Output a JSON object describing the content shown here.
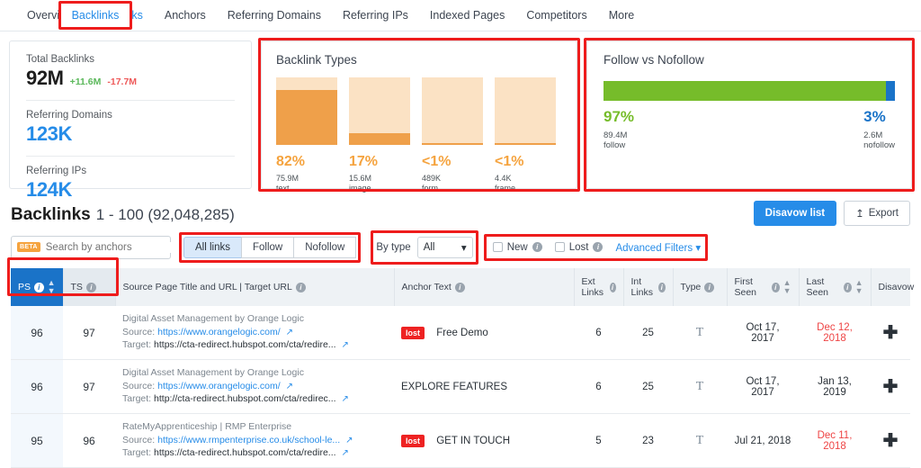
{
  "nav": {
    "items": [
      {
        "label": "Overview",
        "active": false
      },
      {
        "label": "Backlinks",
        "active": true
      },
      {
        "label": "Anchors",
        "active": false
      },
      {
        "label": "Referring Domains",
        "active": false
      },
      {
        "label": "Referring IPs",
        "active": false
      },
      {
        "label": "Indexed Pages",
        "active": false
      },
      {
        "label": "Competitors",
        "active": false
      },
      {
        "label": "More",
        "active": false
      }
    ]
  },
  "stats": {
    "total_backlinks": {
      "label": "Total Backlinks",
      "value": "92M",
      "delta_up": "+11.6M",
      "delta_down": "-17.7M"
    },
    "referring_domains": {
      "label": "Referring Domains",
      "value": "123K"
    },
    "referring_ips": {
      "label": "Referring IPs",
      "value": "124K"
    }
  },
  "chart_data": [
    {
      "type": "bar",
      "title": "Backlink Types",
      "categories": [
        "text",
        "image",
        "form",
        "frame"
      ],
      "values": [
        82,
        17,
        0.5,
        0.01
      ],
      "value_labels": [
        "82%",
        "17%",
        "<1%",
        "<1%"
      ],
      "absolute_labels": [
        "75.9M",
        "15.6M",
        "489K",
        "4.4K"
      ],
      "ylim": [
        0,
        100
      ],
      "xlabel": "",
      "ylabel": "",
      "grid": false,
      "colors": {
        "fill": "#efa04a",
        "track": "#fbe2c4",
        "label": "#f5a33e"
      }
    },
    {
      "type": "bar",
      "title": "Follow vs Nofollow",
      "orientation": "horizontal-stacked",
      "categories": [
        "follow",
        "nofollow"
      ],
      "values": [
        97,
        3
      ],
      "value_labels": [
        "97%",
        "3%"
      ],
      "absolute_labels": [
        "89.4M",
        "2.6M"
      ],
      "ylim": [
        0,
        100
      ],
      "grid": false,
      "colors": {
        "follow": "#76bc2a",
        "nofollow": "#1a73c8"
      }
    }
  ],
  "backlinks_header": {
    "title": "Backlinks",
    "range_count": "1 - 100 (92,048,285)",
    "disavow_button": "Disavow list",
    "export_button": "Export",
    "export_icon": "upload-icon"
  },
  "toolbar": {
    "search": {
      "beta_badge": "BETA",
      "placeholder": "Search by anchors",
      "value": "",
      "icon": "search-icon"
    },
    "segments": [
      {
        "label": "All links",
        "active": true
      },
      {
        "label": "Follow",
        "active": false
      },
      {
        "label": "Nofollow",
        "active": false
      }
    ],
    "by_type": {
      "label": "By type",
      "selected": "All",
      "options": [
        "All"
      ]
    },
    "checkboxes": [
      {
        "label": "New",
        "checked": false
      },
      {
        "label": "Lost",
        "checked": false
      }
    ],
    "advanced_filters": "Advanced Filters"
  },
  "table": {
    "columns": [
      {
        "key": "ps",
        "label": "PS",
        "info": true,
        "sortable": true,
        "active": true
      },
      {
        "key": "ts",
        "label": "TS",
        "info": true,
        "sortable": false,
        "active": false
      },
      {
        "key": "source",
        "label": "Source Page Title and URL | Target URL",
        "info": true,
        "sortable": false
      },
      {
        "key": "anchor",
        "label": "Anchor Text",
        "info": true,
        "sortable": false
      },
      {
        "key": "ext",
        "label": "Ext Links",
        "info": true,
        "sortable": false
      },
      {
        "key": "int",
        "label": "Int Links",
        "info": true,
        "sortable": false
      },
      {
        "key": "type",
        "label": "Type",
        "info": true,
        "sortable": false
      },
      {
        "key": "first_seen",
        "label": "First Seen",
        "info": true,
        "sortable": true
      },
      {
        "key": "last_seen",
        "label": "Last Seen",
        "info": true,
        "sortable": true
      },
      {
        "key": "disavow",
        "label": "Disavow",
        "info": false,
        "sortable": false
      }
    ],
    "source_prefix": "Source:",
    "target_prefix": "Target:",
    "lost_badge": "lost",
    "rows": [
      {
        "ps": "96",
        "ts": "97",
        "page_title": "Digital Asset Management by Orange Logic",
        "source_url": "https://www.orangelogic.com/",
        "target_url": "https://cta-redirect.hubspot.com/cta/redire...",
        "lost": true,
        "anchor": "Free Demo",
        "ext": "6",
        "int": "25",
        "type_icon": "text-type-icon",
        "first_seen": "Oct 17, 2017",
        "last_seen": "Dec 12, 2018",
        "last_seen_red": true,
        "disavow_icon": "plus-icon"
      },
      {
        "ps": "96",
        "ts": "97",
        "page_title": "Digital Asset Management by Orange Logic",
        "source_url": "https://www.orangelogic.com/",
        "target_url": "http://cta-redirect.hubspot.com/cta/redirec...",
        "lost": false,
        "anchor": "EXPLORE FEATURES",
        "ext": "6",
        "int": "25",
        "type_icon": "text-type-icon",
        "first_seen": "Oct 17, 2017",
        "last_seen": "Jan 13, 2019",
        "last_seen_red": false,
        "disavow_icon": "plus-icon"
      },
      {
        "ps": "95",
        "ts": "96",
        "page_title": "RateMyApprenticeship | RMP Enterprise",
        "source_url": "https://www.rmpenterprise.co.uk/school-le...",
        "target_url": "https://cta-redirect.hubspot.com/cta/redire...",
        "lost": true,
        "anchor": "GET IN TOUCH",
        "ext": "5",
        "int": "23",
        "type_icon": "text-type-icon",
        "first_seen": "Jul 21, 2018",
        "last_seen": "Dec 11, 2018",
        "last_seen_red": true,
        "disavow_icon": "plus-icon"
      }
    ]
  },
  "colors": {
    "accent_blue": "#268ce8",
    "header_blue": "#1a73c8",
    "orange": "#efa04a",
    "orange_light": "#fbe2c4",
    "green": "#76bc2a",
    "red": "#ee2222",
    "highlight": "#ee1c1c"
  }
}
